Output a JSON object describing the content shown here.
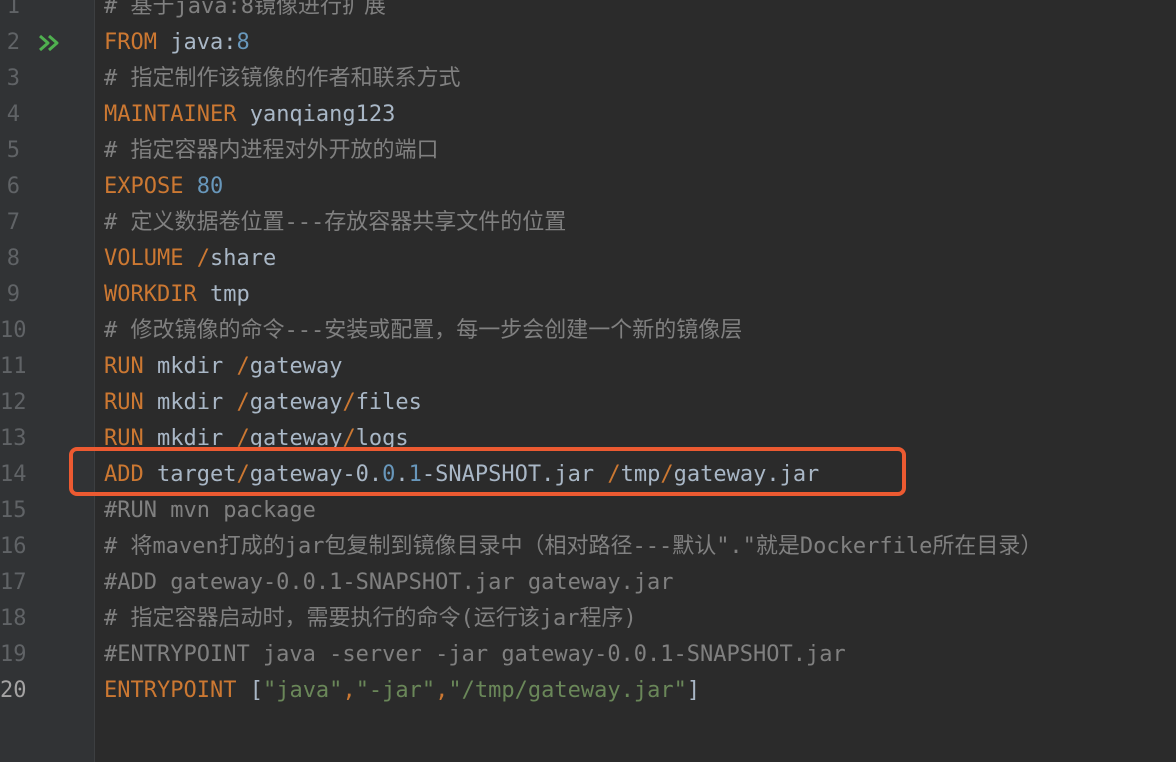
{
  "gutter": {
    "line_numbers": [
      "1",
      "2",
      "3",
      "4",
      "5",
      "6",
      "7",
      "8",
      "9",
      "10",
      "11",
      "12",
      "13",
      "14",
      "15",
      "16",
      "17",
      "18",
      "19",
      "20"
    ],
    "current_line": "20",
    "run_icon": "run-double-arrow-icon",
    "run_icon_color": "#4fb04f"
  },
  "code": {
    "lines": [
      {
        "parts": [
          {
            "cls": "cm",
            "text": "# 基于java:8镜像进行扩展"
          }
        ]
      },
      {
        "parts": [
          {
            "cls": "kw",
            "text": "FROM"
          },
          {
            "cls": "arg",
            "text": " java:"
          },
          {
            "cls": "num",
            "text": "8"
          }
        ]
      },
      {
        "parts": [
          {
            "cls": "cm",
            "text": "# 指定制作该镜像的作者和联系方式"
          }
        ]
      },
      {
        "parts": [
          {
            "cls": "kw",
            "text": "MAINTAINER"
          },
          {
            "cls": "arg",
            "text": " yanqiang123"
          }
        ]
      },
      {
        "parts": [
          {
            "cls": "cm",
            "text": "# 指定容器内进程对外开放的端口"
          }
        ]
      },
      {
        "parts": [
          {
            "cls": "kw",
            "text": "EXPOSE"
          },
          {
            "cls": "arg",
            "text": " "
          },
          {
            "cls": "num",
            "text": "80"
          }
        ]
      },
      {
        "parts": [
          {
            "cls": "cm",
            "text": "# 定义数据卷位置---存放容器共享文件的位置"
          }
        ]
      },
      {
        "parts": [
          {
            "cls": "kw",
            "text": "VOLUME"
          },
          {
            "cls": "arg",
            "text": " "
          },
          {
            "cls": "kw",
            "text": "/"
          },
          {
            "cls": "arg",
            "text": "share"
          }
        ]
      },
      {
        "parts": [
          {
            "cls": "kw",
            "text": "WORKDIR"
          },
          {
            "cls": "arg",
            "text": " tmp"
          }
        ]
      },
      {
        "parts": [
          {
            "cls": "cm",
            "text": "# 修改镜像的命令---安装或配置，每一步会创建一个新的镜像层"
          }
        ]
      },
      {
        "parts": [
          {
            "cls": "kw",
            "text": "RUN"
          },
          {
            "cls": "arg",
            "text": " mkdir "
          },
          {
            "cls": "kw",
            "text": "/"
          },
          {
            "cls": "arg",
            "text": "gateway"
          }
        ]
      },
      {
        "parts": [
          {
            "cls": "kw",
            "text": "RUN"
          },
          {
            "cls": "arg",
            "text": " mkdir "
          },
          {
            "cls": "kw",
            "text": "/"
          },
          {
            "cls": "arg",
            "text": "gateway"
          },
          {
            "cls": "kw",
            "text": "/"
          },
          {
            "cls": "arg",
            "text": "files"
          }
        ]
      },
      {
        "parts": [
          {
            "cls": "kw",
            "text": "RUN"
          },
          {
            "cls": "arg",
            "text": " mkdir "
          },
          {
            "cls": "kw",
            "text": "/"
          },
          {
            "cls": "arg",
            "text": "gateway"
          },
          {
            "cls": "kw",
            "text": "/"
          },
          {
            "cls": "arg",
            "text": "logs"
          }
        ]
      },
      {
        "parts": [
          {
            "cls": "kw",
            "text": "ADD"
          },
          {
            "cls": "arg",
            "text": " target"
          },
          {
            "cls": "kw",
            "text": "/"
          },
          {
            "cls": "arg",
            "text": "gateway-0."
          },
          {
            "cls": "num",
            "text": "0"
          },
          {
            "cls": "arg",
            "text": "."
          },
          {
            "cls": "num",
            "text": "1"
          },
          {
            "cls": "arg",
            "text": "-SNAPSHOT.jar "
          },
          {
            "cls": "kw",
            "text": "/"
          },
          {
            "cls": "arg",
            "text": "tmp"
          },
          {
            "cls": "kw",
            "text": "/"
          },
          {
            "cls": "arg",
            "text": "gateway.jar"
          }
        ]
      },
      {
        "parts": [
          {
            "cls": "cm",
            "text": "#RUN mvn package"
          }
        ]
      },
      {
        "parts": [
          {
            "cls": "cm",
            "text": "# 将maven打成的jar包复制到镜像目录中（相对路径---默认\".\"就是Dockerfile所在目录）"
          }
        ]
      },
      {
        "parts": [
          {
            "cls": "cm",
            "text": "#ADD gateway-0.0.1-SNAPSHOT.jar gateway.jar"
          }
        ]
      },
      {
        "parts": [
          {
            "cls": "cm",
            "text": "# 指定容器启动时，需要执行的命令(运行该jar程序)"
          }
        ]
      },
      {
        "parts": [
          {
            "cls": "cm",
            "text": "#ENTRYPOINT java -server -jar gateway-0.0.1-SNAPSHOT.jar"
          }
        ]
      },
      {
        "parts": [
          {
            "cls": "kw",
            "text": "ENTRYPOINT"
          },
          {
            "cls": "arg",
            "text": " ["
          },
          {
            "cls": "str",
            "text": "\"java\""
          },
          {
            "cls": "kw",
            "text": ","
          },
          {
            "cls": "str",
            "text": "\"-jar\""
          },
          {
            "cls": "kw",
            "text": ","
          },
          {
            "cls": "str",
            "text": "\"/tmp/gateway.jar\""
          },
          {
            "cls": "arg",
            "text": "]"
          }
        ]
      }
    ],
    "highlighted_line": "14",
    "highlight_color": "#ec5a31"
  }
}
